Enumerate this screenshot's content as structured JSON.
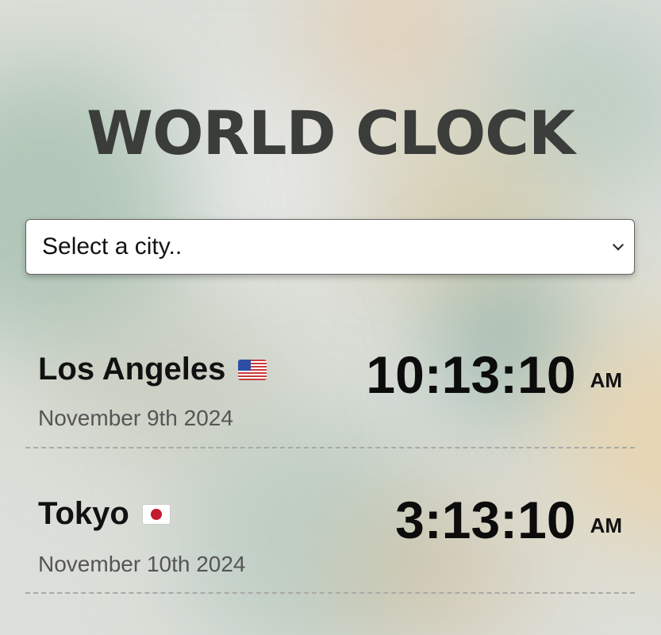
{
  "header": {
    "title": "WORLD CLOCK"
  },
  "city_select": {
    "placeholder": "Select a city..",
    "icon": "chevron-down-icon"
  },
  "cities": [
    {
      "name": "Los Angeles",
      "flag": "us-flag",
      "date": "November 9th 2024",
      "time": "10:13:10",
      "period": "AM"
    },
    {
      "name": "Tokyo",
      "flag": "japan-flag",
      "date": "November 10th 2024",
      "time": "3:13:10",
      "period": "AM"
    }
  ]
}
